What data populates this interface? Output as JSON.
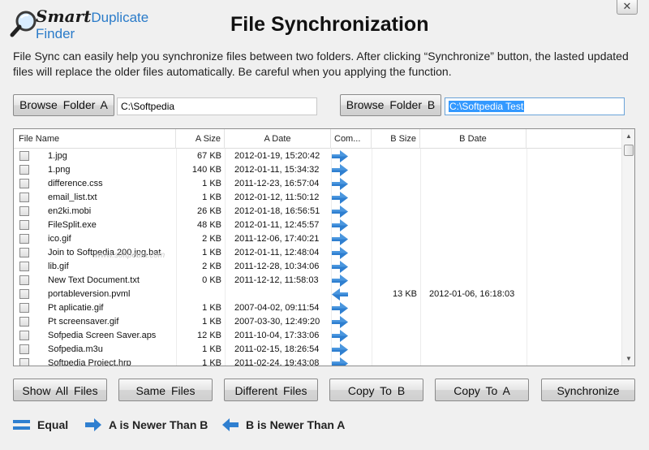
{
  "header": {
    "logo_smart": "Smart",
    "logo_rest": "Duplicate Finder",
    "title": "File Synchronization",
    "close_symbol": "✕",
    "description": "File Sync can easily help you synchronize files between two folders. After clicking “Synchronize” button, the lasted updated files will replace the older files automatically. Be careful when you applying the function."
  },
  "folders": {
    "browse_a_label": "Browse  Folder  A",
    "path_a": "C:\\Softpedia",
    "browse_b_label": "Browse  Folder  B",
    "path_b": "C:\\Softpedia Test"
  },
  "watermark": "www.softpedia.com",
  "table": {
    "columns": {
      "file_name": "File Name",
      "a_size": "A Size",
      "a_date": "A Date",
      "compare": "Com...",
      "b_size": "B Size",
      "b_date": "B Date"
    },
    "rows": [
      {
        "name": "1.jpg",
        "a_size": "67 KB",
        "a_date": "2012-01-19, 15:20:42",
        "cmp": "a-newer",
        "b_size": "",
        "b_date": ""
      },
      {
        "name": "1.png",
        "a_size": "140 KB",
        "a_date": "2012-01-11, 15:34:32",
        "cmp": "a-newer",
        "b_size": "",
        "b_date": ""
      },
      {
        "name": "difference.css",
        "a_size": "1 KB",
        "a_date": "2011-12-23, 16:57:04",
        "cmp": "a-newer",
        "b_size": "",
        "b_date": ""
      },
      {
        "name": "email_list.txt",
        "a_size": "1 KB",
        "a_date": "2012-01-12, 11:50:12",
        "cmp": "a-newer",
        "b_size": "",
        "b_date": ""
      },
      {
        "name": "en2ki.mobi",
        "a_size": "26 KB",
        "a_date": "2012-01-18, 16:56:51",
        "cmp": "a-newer",
        "b_size": "",
        "b_date": ""
      },
      {
        "name": "FileSplit.exe",
        "a_size": "48 KB",
        "a_date": "2012-01-11, 12:45:57",
        "cmp": "a-newer",
        "b_size": "",
        "b_date": ""
      },
      {
        "name": "ico.gif",
        "a_size": "2 KB",
        "a_date": "2011-12-06, 17:40:21",
        "cmp": "a-newer",
        "b_size": "",
        "b_date": ""
      },
      {
        "name": "Join to Softpedia 200.jpg.bat",
        "a_size": "1 KB",
        "a_date": "2012-01-11, 12:48:04",
        "cmp": "a-newer",
        "b_size": "",
        "b_date": ""
      },
      {
        "name": "lib.gif",
        "a_size": "2 KB",
        "a_date": "2011-12-28, 10:34:06",
        "cmp": "a-newer",
        "b_size": "",
        "b_date": ""
      },
      {
        "name": "New Text Document.txt",
        "a_size": "0 KB",
        "a_date": "2011-12-12, 11:58:03",
        "cmp": "a-newer",
        "b_size": "",
        "b_date": ""
      },
      {
        "name": "portableversion.pvml",
        "a_size": "",
        "a_date": "",
        "cmp": "b-newer",
        "b_size": "13 KB",
        "b_date": "2012-01-06, 16:18:03"
      },
      {
        "name": "Pt aplicatie.gif",
        "a_size": "1 KB",
        "a_date": "2007-04-02, 09:11:54",
        "cmp": "a-newer",
        "b_size": "",
        "b_date": ""
      },
      {
        "name": "Pt screensaver.gif",
        "a_size": "1 KB",
        "a_date": "2007-03-30, 12:49:20",
        "cmp": "a-newer",
        "b_size": "",
        "b_date": ""
      },
      {
        "name": "Sofpedia Screen Saver.aps",
        "a_size": "12 KB",
        "a_date": "2011-10-04, 17:33:06",
        "cmp": "a-newer",
        "b_size": "",
        "b_date": ""
      },
      {
        "name": "Sofpedia.m3u",
        "a_size": "1 KB",
        "a_date": "2011-02-15, 18:26:54",
        "cmp": "a-newer",
        "b_size": "",
        "b_date": ""
      },
      {
        "name": "Softpedia Project.hrp",
        "a_size": "1 KB",
        "a_date": "2011-02-24, 19:43:08",
        "cmp": "a-newer",
        "b_size": "",
        "b_date": ""
      }
    ]
  },
  "buttons": {
    "show_all": "Show  All  Files",
    "same": "Same  Files",
    "different": "Different  Files",
    "copy_to_b": "Copy   To B",
    "copy_to_a": "Copy    To  A",
    "synchronize": "Synchronize"
  },
  "legend": {
    "equal": "Equal",
    "a_newer": "A is Newer Than B",
    "b_newer": "B is Newer Than A"
  },
  "colors": {
    "arrow_blue": "#2f7fd0",
    "selection": "#3399ff",
    "logo_blue": "#2a7bc9"
  }
}
